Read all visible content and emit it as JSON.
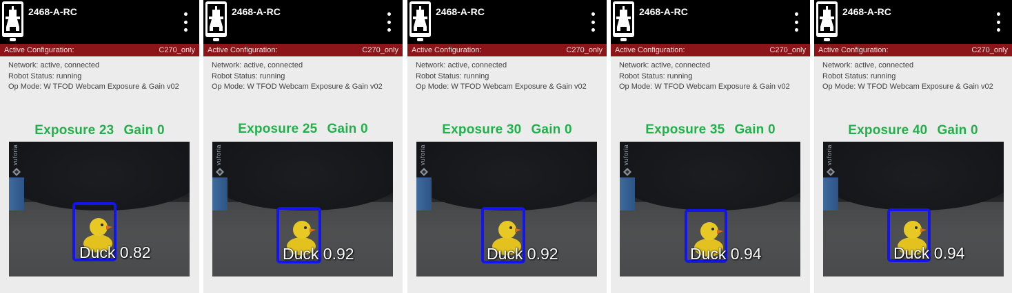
{
  "panels": [
    {
      "device_name": "2468-A-RC",
      "config_label": "Active Configuration:",
      "config_value": "C270_only",
      "network": "Network: active, connected",
      "robot_status": "Robot Status: running",
      "op_mode": "Op Mode: W TFOD Webcam Exposure & Gain v02",
      "exposure_text": "Exposure 23",
      "gain_text": "Gain 0",
      "vuforia_text": "vuforia",
      "detection_label": "Duck 0.82"
    },
    {
      "device_name": "2468-A-RC",
      "config_label": "Active Configuration:",
      "config_value": "C270_only",
      "network": "Network: active, connected",
      "robot_status": "Robot Status: running",
      "op_mode": "Op Mode: W TFOD Webcam Exposure & Gain v02",
      "exposure_text": "Exposure 25",
      "gain_text": "Gain 0",
      "vuforia_text": "vuforia",
      "detection_label": "Duck 0.92"
    },
    {
      "device_name": "2468-A-RC",
      "config_label": "Active Configuration:",
      "config_value": "C270_only",
      "network": "Network: active, connected",
      "robot_status": "Robot Status: running",
      "op_mode": "Op Mode: W TFOD Webcam Exposure & Gain v02",
      "exposure_text": "Exposure 30",
      "gain_text": "Gain 0",
      "vuforia_text": "vuforia",
      "detection_label": "Duck 0.92"
    },
    {
      "device_name": "2468-A-RC",
      "config_label": "Active Configuration:",
      "config_value": "C270_only",
      "network": "Network: active, connected",
      "robot_status": "Robot Status: running",
      "op_mode": "Op Mode: W TFOD Webcam Exposure & Gain v02",
      "exposure_text": "Exposure 35",
      "gain_text": "Gain 0",
      "vuforia_text": "vuforia",
      "detection_label": "Duck 0.94"
    },
    {
      "device_name": "2468-A-RC",
      "config_label": "Active Configuration:",
      "config_value": "C270_only",
      "network": "Network: active, connected",
      "robot_status": "Robot Status: running",
      "op_mode": "Op Mode: W TFOD Webcam Exposure & Gain v02",
      "exposure_text": "Exposure 40",
      "gain_text": "Gain 0",
      "vuforia_text": "vuforia",
      "detection_label": "Duck 0.94"
    }
  ],
  "icons": {
    "robot": "robot-controller-icon",
    "menu": "overflow-menu-icon",
    "vuforia": "vuforia-logo-icon",
    "duck": "rubber-duck"
  },
  "colors": {
    "top_bar": "#000000",
    "config_bar": "#8c1519",
    "headline": "#21b14a",
    "bounding_box": "#1414ee",
    "panel_bg": "#ececec"
  }
}
